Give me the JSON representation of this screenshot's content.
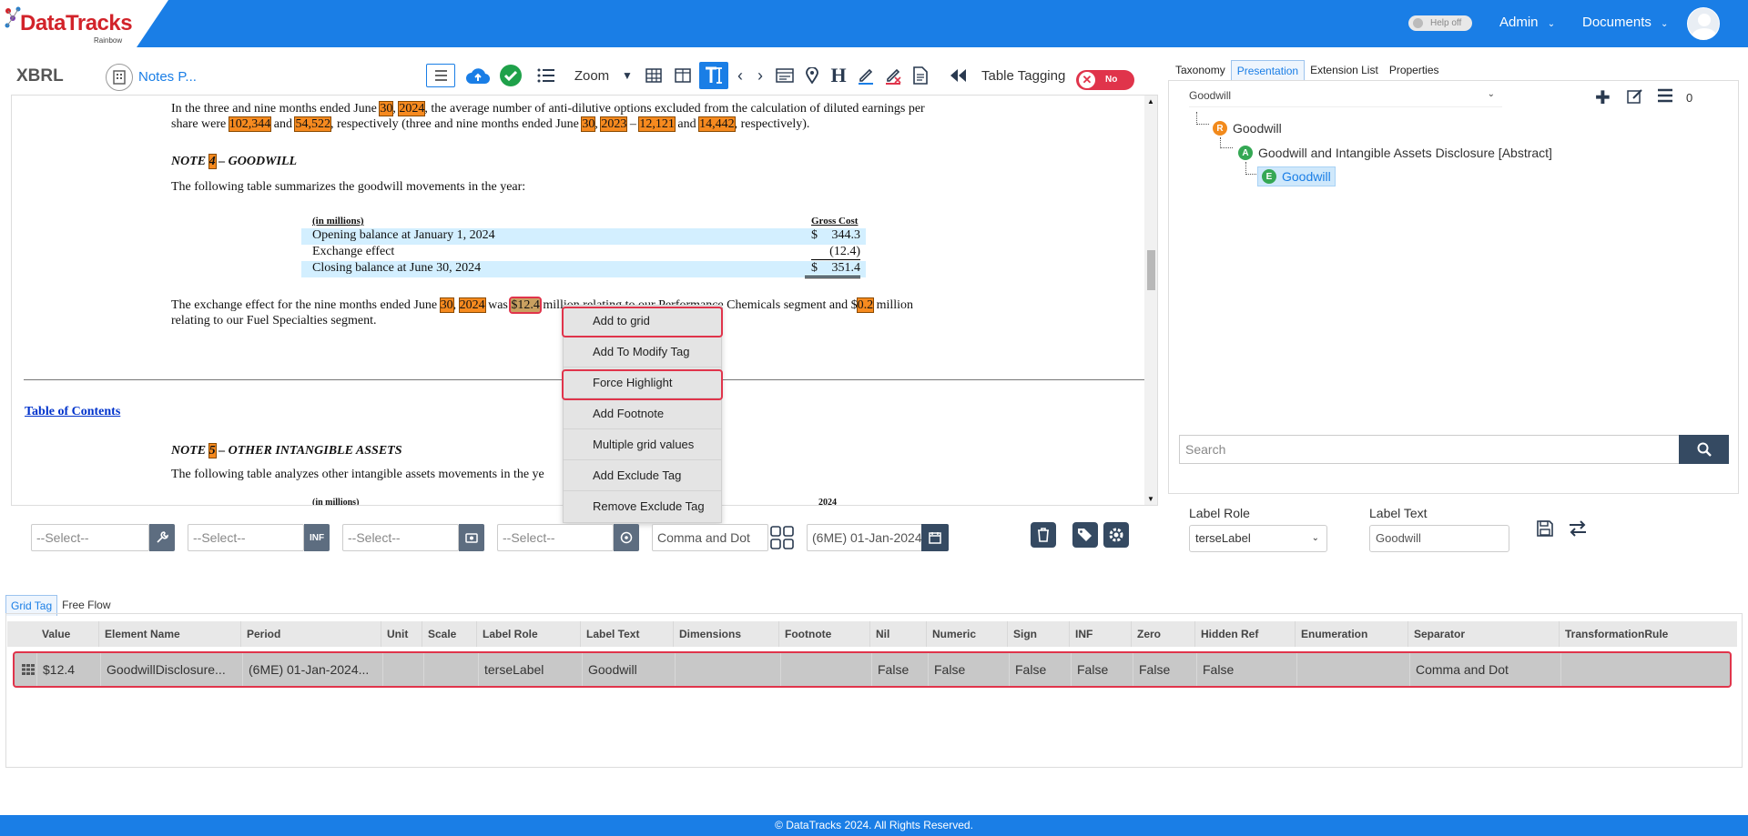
{
  "header": {
    "logo_text": "DataTracks",
    "logo_sub": "Rainbow",
    "help_label": "Help off",
    "admin_label": "Admin",
    "documents_label": "Documents"
  },
  "toolbar": {
    "xbrl_label": "XBRL",
    "notes_label": "Notes P...",
    "zoom_label": "Zoom",
    "table_tagging_label": "Table Tagging",
    "toggle_label": "No"
  },
  "document": {
    "p1_line1": [
      "In the three and nine months ended June ",
      "30",
      ", ",
      "2024",
      ", the average number of anti-dilutive options excluded from the calculation of diluted earnings per"
    ],
    "p1_line2": [
      "share were ",
      "102,344",
      " and ",
      "54,522",
      ", respectively (three and nine months ended June ",
      "30",
      ", ",
      "2023",
      " – ",
      "12,121",
      " and ",
      "14,442",
      ", respectively)."
    ],
    "note4_heading": [
      "NOTE ",
      "4",
      " – GOODWILL"
    ],
    "note4_intro": "The following table summarizes the goodwill movements in the year:",
    "table": {
      "col_label": "(in millions)",
      "col_value": "Gross Cost",
      "rows": [
        {
          "label": "Opening balance at January 1, 2024",
          "cur": "$",
          "value": "344.3"
        },
        {
          "label": "Exchange effect",
          "cur": "",
          "value": "(12.4)"
        },
        {
          "label": "Closing balance at June 30, 2024",
          "cur": "$",
          "value": "351.4"
        }
      ]
    },
    "p2_line1": [
      "The exchange effect for the nine months ended June ",
      "30",
      ", ",
      "2024",
      " was ",
      "$12.4",
      " million relating to our Performance Chemicals segment and $",
      "0.2",
      " million"
    ],
    "p2_line2": "relating to our Fuel Specialties segment.",
    "toc_link": "Table of Contents",
    "note5_heading": [
      "NOTE ",
      "5",
      " – OTHER INTANGIBLE ASSETS"
    ],
    "note5_intro": "The following table analyzes other intangible assets movements in the ye",
    "t2_col_label": "(in millions)",
    "t2_col_value": "2024"
  },
  "context_menu": {
    "items": [
      "Add to grid",
      "Add To Modify Tag",
      "Force Highlight",
      "Add Footnote",
      "Multiple grid values",
      "Add Exclude Tag",
      "Remove Exclude Tag"
    ]
  },
  "right_panel": {
    "tabs": [
      "Taxonomy",
      "Presentation",
      "Extension List",
      "Properties"
    ],
    "dropdown_value": "Goodwill",
    "count": "0",
    "tree": [
      {
        "badge": "R",
        "label": "Goodwill"
      },
      {
        "badge": "A",
        "label": "Goodwill and Intangible Assets Disclosure [Abstract]"
      },
      {
        "badge": "E",
        "label": "Goodwill"
      }
    ],
    "search_placeholder": "Search",
    "label_role_title": "Label Role",
    "label_role_value": "terseLabel",
    "label_text_title": "Label Text",
    "label_text_value": "Goodwill"
  },
  "filters": {
    "select1": "--Select--",
    "select2": "--Select--",
    "inf_label": "INF",
    "select3": "--Select--",
    "select4": "--Select--",
    "separator": "Comma and Dot",
    "period": "(6ME) 01-Jan-2024"
  },
  "grid": {
    "tabs": [
      "Grid Tag",
      "Free Flow"
    ],
    "columns": [
      "Value",
      "Element Name",
      "Period",
      "Unit",
      "Scale",
      "Label Role",
      "Label Text",
      "Dimensions",
      "Footnote",
      "Nil",
      "Numeric",
      "Sign",
      "INF",
      "Zero",
      "Hidden Ref",
      "Enumeration",
      "Separator",
      "TransformationRule"
    ],
    "row": [
      "$12.4",
      "GoodwillDisclosure...",
      "(6ME) 01-Jan-2024...",
      "",
      "",
      "terseLabel",
      "Goodwill",
      "",
      "",
      "False",
      "False",
      "False",
      "False",
      "False",
      "False",
      "",
      "Comma and Dot",
      ""
    ]
  },
  "footer": "© DataTracks 2024. All Rights Reserved.",
  "colors": {
    "primary": "#1a7ee6",
    "highlight": "#f68a1f",
    "red": "#e0344b"
  }
}
